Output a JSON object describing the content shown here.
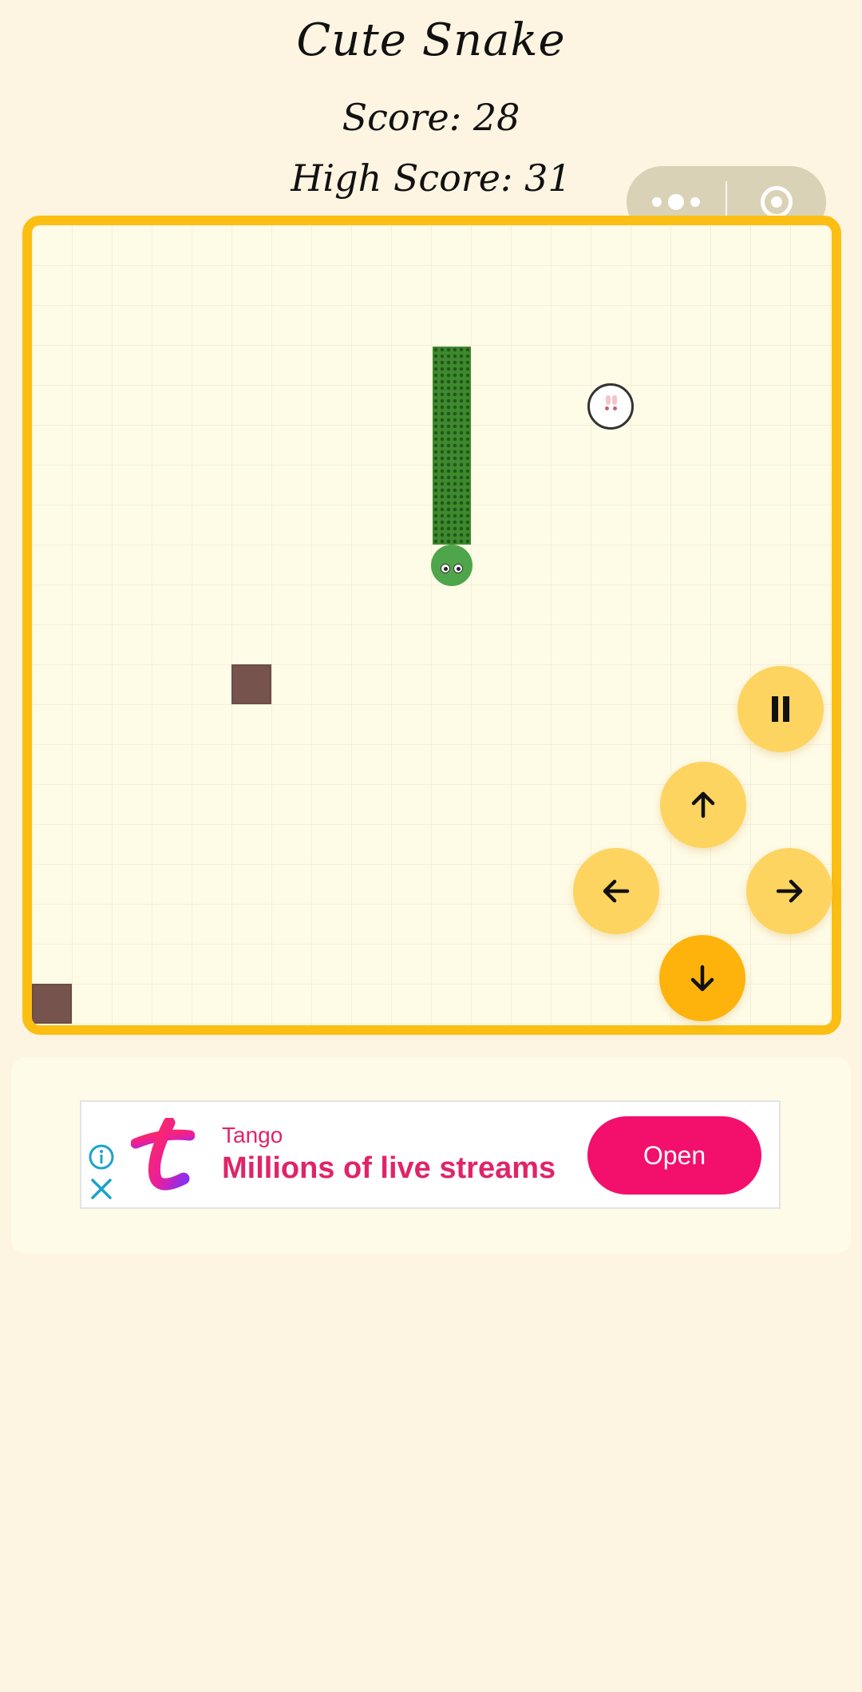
{
  "header": {
    "title": "Cute Snake",
    "score_text": "Score: 28",
    "high_score_text": "High Score: 31"
  },
  "game": {
    "score": 28,
    "high_score": 31,
    "food": "bunny",
    "obstacles": 2
  },
  "miniprogram_menu": {
    "more_icon": "more-dots-icon",
    "close_icon": "target-circle-icon"
  },
  "controls": {
    "pause_icon": "pause-icon",
    "up_icon": "arrow-up-icon",
    "left_icon": "arrow-left-icon",
    "right_icon": "arrow-right-icon",
    "down_icon": "arrow-down-icon"
  },
  "ad": {
    "brand": "Tango",
    "headline": "Millions of live streams",
    "cta": "Open",
    "accent_color": "#f3106c"
  },
  "colors": {
    "background": "#fdf5e1",
    "board_border": "#fbbf14",
    "snake": "#3d8a2e",
    "button": "#fed460",
    "button_active": "#fdb30c"
  }
}
